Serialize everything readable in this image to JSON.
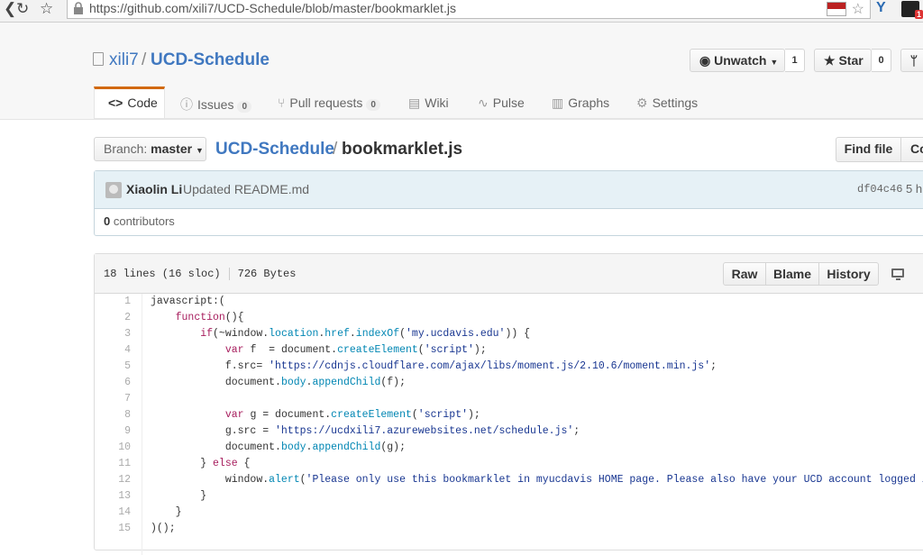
{
  "browser": {
    "url": "https://github.com/xili7/UCD-Schedule/blob/master/bookmarklet.js"
  },
  "repo": {
    "owner": "xili7",
    "separator": "/",
    "name": "UCD-Schedule",
    "watch_label": "Unwatch",
    "watch_count": "1",
    "star_label": "Star",
    "star_count": "0"
  },
  "tabs": [
    {
      "label": "Code",
      "icon": "code-icon"
    },
    {
      "label": "Issues",
      "count": "0",
      "icon": "issue-icon"
    },
    {
      "label": "Pull requests",
      "count": "0",
      "icon": "pull-request-icon"
    },
    {
      "label": "Wiki",
      "icon": "book-icon"
    },
    {
      "label": "Pulse",
      "icon": "pulse-icon"
    },
    {
      "label": "Graphs",
      "icon": "graph-icon"
    },
    {
      "label": "Settings",
      "icon": "gear-icon"
    }
  ],
  "breadcrumb": {
    "branch_prefix": "Branch:",
    "branch": "master",
    "repo": "UCD-Schedule",
    "separator": "/",
    "file": "bookmarklet.js",
    "find_file": "Find file",
    "copy_path_partial": "Co"
  },
  "commit": {
    "author": "Xiaolin Li",
    "message": "Updated README.md",
    "sha": "df04c46",
    "age_partial": "5 h",
    "contributors_count": "0",
    "contributors_label": "contributors"
  },
  "file": {
    "lines": "18 lines (16 sloc)",
    "size": "726 Bytes",
    "raw": "Raw",
    "blame": "Blame",
    "history": "History"
  },
  "code_lines": [
    {
      "n": "1"
    },
    {
      "n": "2"
    },
    {
      "n": "3"
    },
    {
      "n": "4"
    },
    {
      "n": "5"
    },
    {
      "n": "6"
    },
    {
      "n": "7"
    },
    {
      "n": "8"
    },
    {
      "n": "9"
    },
    {
      "n": "10"
    },
    {
      "n": "11"
    },
    {
      "n": "12"
    },
    {
      "n": "13"
    },
    {
      "n": "14"
    },
    {
      "n": "15"
    }
  ],
  "code": {
    "l1": "javascript:(",
    "l2a": "    ",
    "l2b": "function",
    "l2c": "(){",
    "l3a": "        ",
    "l3b": "if",
    "l3c": "(~window.",
    "l3d": "location",
    "l3e": ".",
    "l3f": "href",
    "l3g": ".",
    "l3h": "indexOf",
    "l3i": "(",
    "l3j": "'my.ucdavis.edu'",
    "l3k": ")) {",
    "l4a": "            ",
    "l4b": "var",
    "l4c": " f  = document.",
    "l4d": "createElement",
    "l4e": "(",
    "l4f": "'script'",
    "l4g": ");",
    "l5a": "            f.src= ",
    "l5b": "'https://cdnjs.cloudflare.com/ajax/libs/moment.js/2.10.6/moment.min.js'",
    "l5c": ";",
    "l6a": "            document.",
    "l6b": "body",
    "l6c": ".",
    "l6d": "appendChild",
    "l6e": "(f);",
    "l8a": "            ",
    "l8b": "var",
    "l8c": " g = document.",
    "l8d": "createElement",
    "l8e": "(",
    "l8f": "'script'",
    "l8g": ");",
    "l9a": "            g.src = ",
    "l9b": "'https://ucdxili7.azurewebsites.net/schedule.js'",
    "l9c": ";",
    "l10a": "            document.",
    "l10b": "body",
    "l10c": ".",
    "l10d": "appendChild",
    "l10e": "(g);",
    "l11a": "        } ",
    "l11b": "else",
    "l11c": " {",
    "l12a": "            window.",
    "l12b": "alert",
    "l12c": "(",
    "l12d": "'Please only use this bookmarklet in myucdavis HOME page. Please also have your UCD account logged in.'",
    "l12e": ");",
    "l13": "        }",
    "l14": "    }",
    "l15": ")();"
  },
  "colors": {
    "link": "#4078c0",
    "tab_accent": "#d26911",
    "commit_bg": "#e6f1f6",
    "keyword": "#a71d5d",
    "string": "#183691",
    "builtin": "#0086b3"
  }
}
